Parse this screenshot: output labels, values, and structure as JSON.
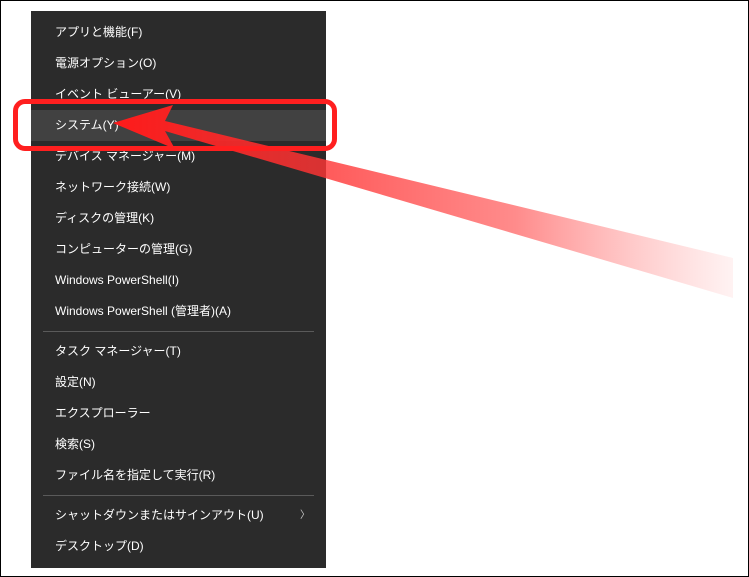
{
  "menu": {
    "group1": [
      {
        "label": "アプリと機能(F)"
      },
      {
        "label": "電源オプション(O)"
      },
      {
        "label": "イベント ビューアー(V)"
      },
      {
        "label": "システム(Y)",
        "hover": true
      },
      {
        "label": "デバイス マネージャー(M)"
      },
      {
        "label": "ネットワーク接続(W)"
      },
      {
        "label": "ディスクの管理(K)"
      },
      {
        "label": "コンピューターの管理(G)"
      },
      {
        "label": "Windows PowerShell(I)"
      },
      {
        "label": "Windows PowerShell (管理者)(A)"
      }
    ],
    "group2": [
      {
        "label": "タスク マネージャー(T)"
      },
      {
        "label": "設定(N)"
      },
      {
        "label": "エクスプローラー"
      },
      {
        "label": "検索(S)"
      },
      {
        "label": "ファイル名を指定して実行(R)"
      }
    ],
    "group3": [
      {
        "label": "シャットダウンまたはサインアウト(U)",
        "submenu": true
      },
      {
        "label": "デスクトップ(D)"
      }
    ]
  }
}
